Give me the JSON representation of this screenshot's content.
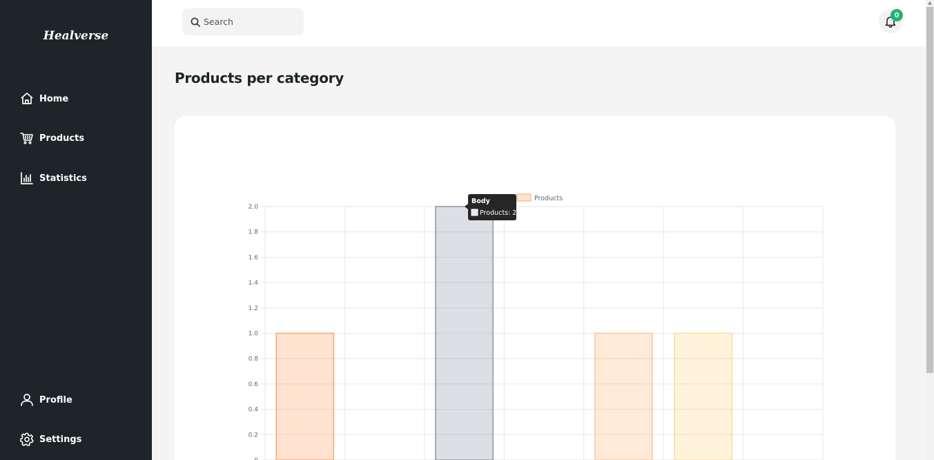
{
  "app": {
    "logo": "Healverse"
  },
  "sidebar": {
    "items": [
      {
        "label": "Home",
        "icon": "home-icon"
      },
      {
        "label": "Products",
        "icon": "cart-icon"
      },
      {
        "label": "Statistics",
        "icon": "bar-chart-icon"
      }
    ],
    "bottom_items": [
      {
        "label": "Profile",
        "icon": "user-icon"
      },
      {
        "label": "Settings",
        "icon": "gear-icon"
      }
    ]
  },
  "header": {
    "search_placeholder": "Search",
    "notification_count": "0"
  },
  "main": {
    "title": "Products per category"
  },
  "colors": {
    "sidebar_bg": "#1d2528",
    "badge": "#22b573"
  },
  "chart_data": {
    "type": "bar",
    "categories": [
      "",
      "",
      "Body",
      "",
      "",
      "",
      ""
    ],
    "series": [
      {
        "name": "Products",
        "values": [
          1,
          0,
          2,
          0,
          1,
          1,
          0
        ]
      }
    ],
    "bar_colors": [
      "rgba(255,159,101,0.3)",
      "",
      "rgba(150,156,170,0.32)",
      "",
      "rgba(255,180,110,0.28)",
      "rgba(255,210,110,0.25)",
      ""
    ],
    "bar_borders": [
      "#f7a872",
      "",
      "#8d93a0",
      "",
      "#f6c7a0",
      "#f8dd9c",
      ""
    ],
    "yticks": [
      "0",
      "0.2",
      "0.4",
      "0.6",
      "0.8",
      "1.0",
      "1.2",
      "1.4",
      "1.6",
      "1.8",
      "2.0"
    ],
    "ylim": [
      0,
      2
    ],
    "legend": {
      "label": "Products",
      "position": "top"
    },
    "tooltip": {
      "title": "Body",
      "body": "Products: 2"
    },
    "grid": true
  }
}
